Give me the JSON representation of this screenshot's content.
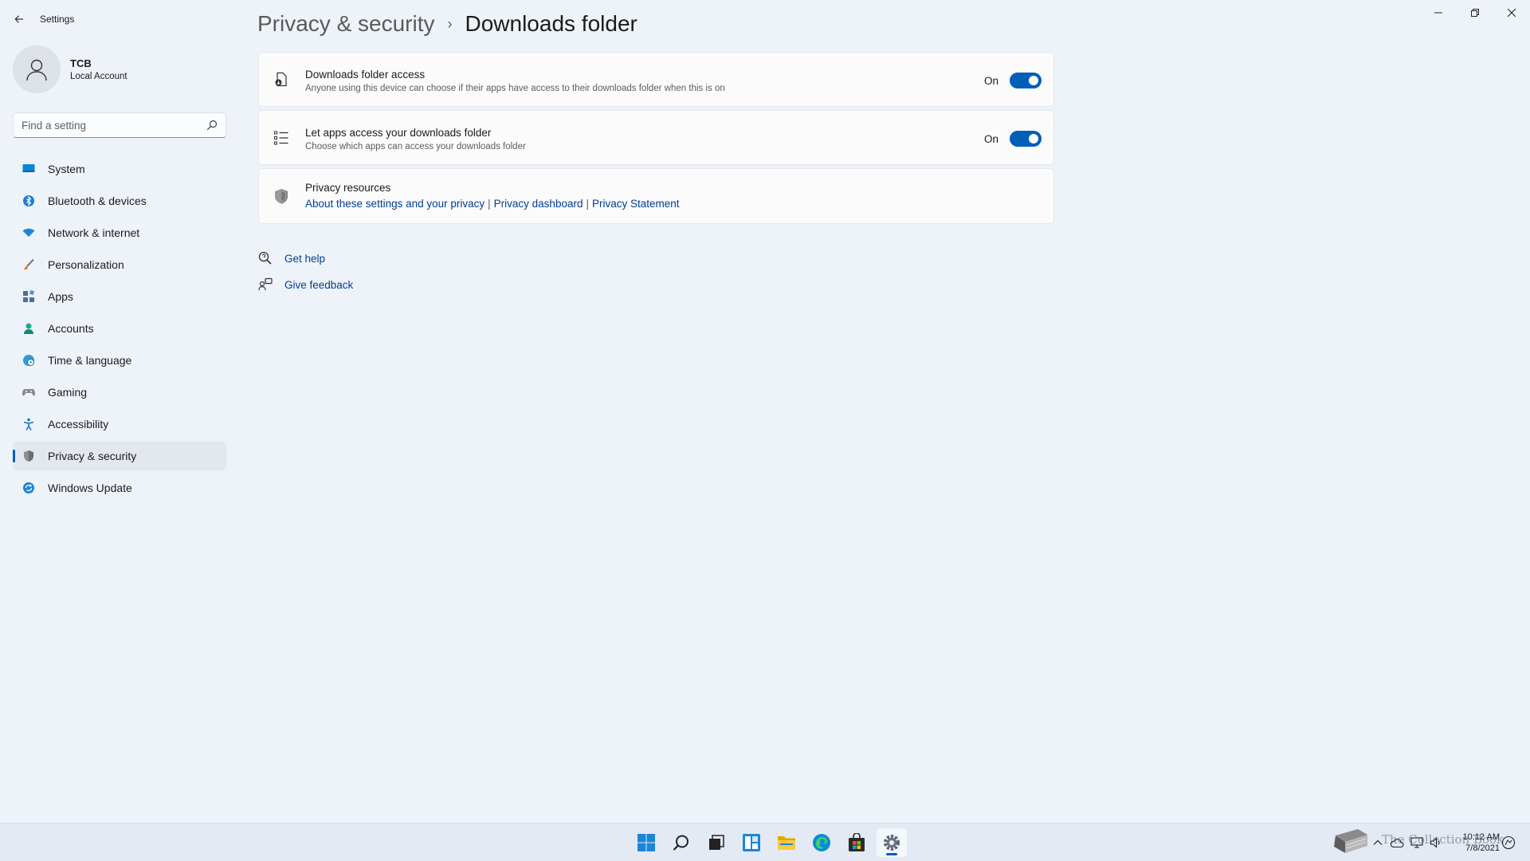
{
  "window": {
    "app_title": "Settings",
    "controls": [
      "minimize",
      "maximize",
      "close"
    ]
  },
  "profile": {
    "name": "TCB",
    "account_type": "Local Account"
  },
  "search": {
    "placeholder": "Find a setting"
  },
  "sidebar": {
    "items": [
      {
        "label": "System",
        "icon": "monitor-icon",
        "active": false
      },
      {
        "label": "Bluetooth & devices",
        "icon": "bluetooth-icon",
        "active": false
      },
      {
        "label": "Network & internet",
        "icon": "wifi-icon",
        "active": false
      },
      {
        "label": "Personalization",
        "icon": "brush-icon",
        "active": false
      },
      {
        "label": "Apps",
        "icon": "apps-icon",
        "active": false
      },
      {
        "label": "Accounts",
        "icon": "person-icon",
        "active": false
      },
      {
        "label": "Time & language",
        "icon": "globe-clock-icon",
        "active": false
      },
      {
        "label": "Gaming",
        "icon": "gamepad-icon",
        "active": false
      },
      {
        "label": "Accessibility",
        "icon": "accessibility-icon",
        "active": false
      },
      {
        "label": "Privacy & security",
        "icon": "shield-icon",
        "active": true
      },
      {
        "label": "Windows Update",
        "icon": "update-icon",
        "active": false
      }
    ]
  },
  "breadcrumb": {
    "parent": "Privacy & security",
    "separator": "›",
    "current": "Downloads folder"
  },
  "settings": {
    "downloads_access": {
      "title": "Downloads folder access",
      "description": "Anyone using this device can choose if their apps have access to their downloads folder when this is on",
      "state_label": "On",
      "enabled": true,
      "icon": "download-folder-icon"
    },
    "let_apps_access": {
      "title": "Let apps access your downloads folder",
      "description": "Choose which apps can access your downloads folder",
      "state_label": "On",
      "enabled": true,
      "icon": "list-icon"
    },
    "privacy_resources": {
      "title": "Privacy resources",
      "icon": "shield-icon",
      "links": [
        "About these settings and your privacy",
        "Privacy dashboard",
        "Privacy Statement"
      ],
      "separator": "|"
    }
  },
  "help": {
    "get_help": "Get help",
    "give_feedback": "Give feedback"
  },
  "taskbar": {
    "apps": [
      "start-icon",
      "search-icon",
      "task-view-icon",
      "widgets-icon",
      "file-explorer-icon",
      "edge-icon",
      "store-icon",
      "settings-icon"
    ],
    "active_app": "settings-icon",
    "clock_time": "10:12 AM",
    "clock_date": "7/8/2021",
    "watermark": "The Collection Book"
  },
  "colors": {
    "accent": "#005fb8",
    "link": "#003e92",
    "background": "#eef3f9",
    "card": "#fbfbfc"
  }
}
